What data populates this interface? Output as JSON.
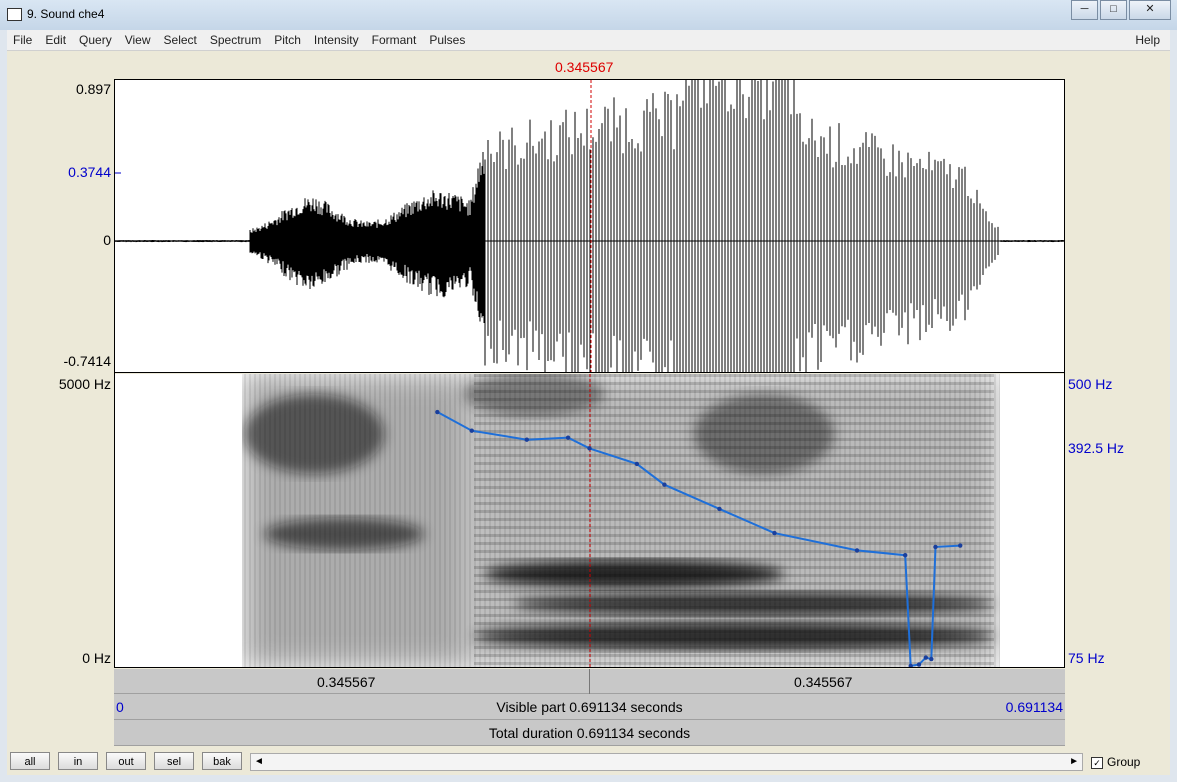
{
  "window": {
    "title": "9. Sound che4",
    "buttons": [
      "─",
      "□",
      "✕"
    ]
  },
  "menu": {
    "items": [
      "File",
      "Edit",
      "Query",
      "View",
      "Select",
      "Spectrum",
      "Pitch",
      "Intensity",
      "Formant",
      "Pulses"
    ],
    "help": "Help"
  },
  "cursor": {
    "time_label": "0.345567",
    "fraction": 0.5
  },
  "waveform": {
    "y_max": "0.897",
    "y_cursor": "0.3744",
    "y_zero": "0",
    "y_min": "-0.7414"
  },
  "spectrogram": {
    "freq_top": "5000 Hz",
    "freq_bottom": "0 Hz",
    "pitch_top": "500 Hz",
    "pitch_cursor": "392.5 Hz",
    "pitch_bottom": "75 Hz"
  },
  "pitch_track": {
    "x_seconds": [
      0.235,
      0.26,
      0.3,
      0.33,
      0.345567,
      0.38,
      0.4,
      0.44,
      0.48,
      0.54,
      0.575,
      0.579,
      0.585,
      0.59,
      0.594,
      0.597,
      0.615
    ],
    "y_hz": [
      445,
      418,
      405,
      408,
      392.5,
      370,
      340,
      305,
      270,
      245,
      238,
      78,
      80,
      90,
      88,
      250,
      252
    ]
  },
  "time_bars": {
    "left_segment": "0.345567",
    "right_segment": "0.345567",
    "visible_start": "0",
    "visible_label": "Visible part 0.691134 seconds",
    "visible_end": "0.691134",
    "total_label": "Total duration 0.691134 seconds"
  },
  "controls": {
    "buttons": [
      "all",
      "in",
      "out",
      "sel",
      "bak"
    ],
    "scroll_left": "◄",
    "scroll_right": "►",
    "group_label": "Group",
    "group_checked": true
  },
  "colors": {
    "cursor": "#d00000",
    "pitch": "#1e6fd9",
    "axis_blue": "#0000cc"
  }
}
